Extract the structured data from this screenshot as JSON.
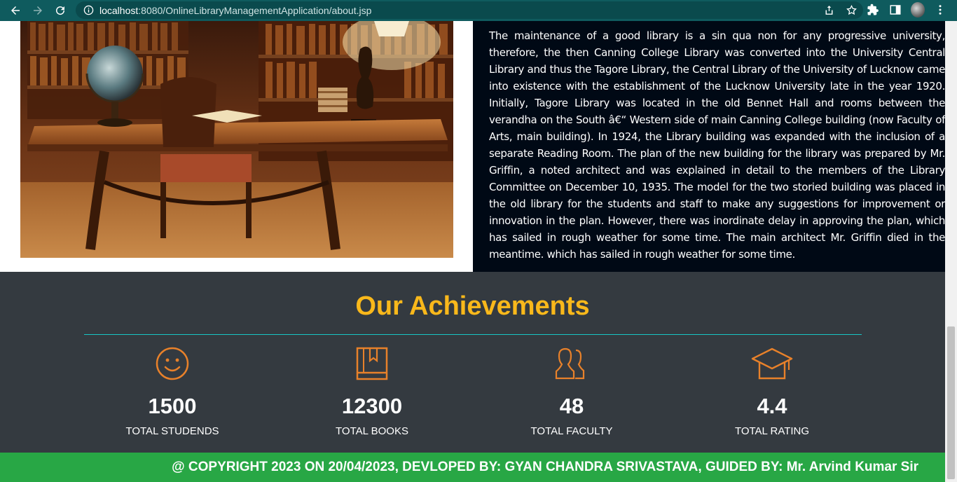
{
  "browser": {
    "url_host": "localhost",
    "url_rest": ":8080/OnlineLibraryManagementApplication/about.jsp"
  },
  "about": {
    "paragraph": "The maintenance of a good library is a sin qua non for any progressive university, therefore, the then Canning College Library was converted into the University Central Library and thus the Tagore Library, the Central Library of the University of Lucknow came into existence with the establishment of the Lucknow University late in the year 1920. Initially, Tagore Library was located in the old Bennet Hall and rooms between the verandha on the South â€“ Western side of main Canning College building (now Faculty of Arts, main building). In 1924, the Library building was expanded with the inclusion of a separate Reading Room. The plan of the new building for the library was prepared by Mr. Griffin, a noted architect and was explained in detail to the members of the Library Committee on December 10, 1935. The model for the two storied building was placed in the old library for the students and staff to make any suggestions for improvement or innovation in the plan. However, there was inordinate delay in approving the plan, which has sailed in rough weather for some time. The main architect Mr. Griffin died in the meantime. which has sailed in rough weather for some time."
  },
  "achievements": {
    "title": "Our Achievements",
    "accent_color": "#f9b81b",
    "icon_color": "#e8812a",
    "stats": [
      {
        "icon": "smile-icon",
        "value": "1500",
        "label": "TOTAL STUDENDS"
      },
      {
        "icon": "book-icon",
        "value": "12300",
        "label": "TOTAL BOOKS"
      },
      {
        "icon": "users-icon",
        "value": "48",
        "label": "TOTAL FACULTY"
      },
      {
        "icon": "graduation-cap-icon",
        "value": "4.4",
        "label": "TOTAL RATING"
      }
    ]
  },
  "footer": {
    "text": "@ COPYRIGHT 2023 ON 20/04/2023, DEVLOPED BY: GYAN CHANDRA SRIVASTAVA, GUIDED BY: Mr. Arvind Kumar Sir"
  }
}
